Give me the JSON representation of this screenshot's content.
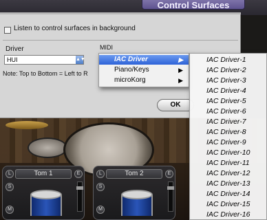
{
  "window": {
    "title_fragment": "Control Surfaces"
  },
  "dialog": {
    "listen_checkbox_label": "Listen to control surfaces in background",
    "listen_checked": false,
    "driver_label": "Driver",
    "midi_label": "MIDI",
    "driver_value": "HUI",
    "note": "Note: Top to Bottom = Left to R",
    "ok_label": "OK"
  },
  "midi_menu": {
    "items": [
      {
        "label": "IAC Driver",
        "selected": true,
        "has_submenu": true
      },
      {
        "label": "Piano/Keys",
        "selected": false,
        "has_submenu": true
      },
      {
        "label": "microKorg",
        "selected": false,
        "has_submenu": true
      }
    ]
  },
  "iac_submenu": {
    "items": [
      "IAC Driver-1",
      "IAC Driver-2",
      "IAC Driver-3",
      "IAC Driver-4",
      "IAC Driver-5",
      "IAC Driver-6",
      "IAC Driver-7",
      "IAC Driver-8",
      "IAC Driver-9",
      "IAC Driver-10",
      "IAC Driver-11",
      "IAC Driver-12",
      "IAC Driver-13",
      "IAC Driver-14",
      "IAC Driver-15",
      "IAC Driver-16"
    ]
  },
  "mixer": {
    "tom1": {
      "name": "Tom 1",
      "left_buttons": [
        "L",
        "S",
        "M"
      ],
      "right_buttons": [
        "E"
      ]
    },
    "tom2": {
      "name": "Tom 2",
      "left_buttons": [
        "L",
        "S",
        "M"
      ],
      "right_buttons": [
        "E"
      ]
    }
  },
  "colors": {
    "menu_highlight": "#2e63d7",
    "tom_shell": "#1e44a0",
    "title_tab": "#6e63a2"
  },
  "icons": {
    "submenu_arrow": "submenu-arrow-icon",
    "select_arrow": "select-arrow-icon"
  }
}
